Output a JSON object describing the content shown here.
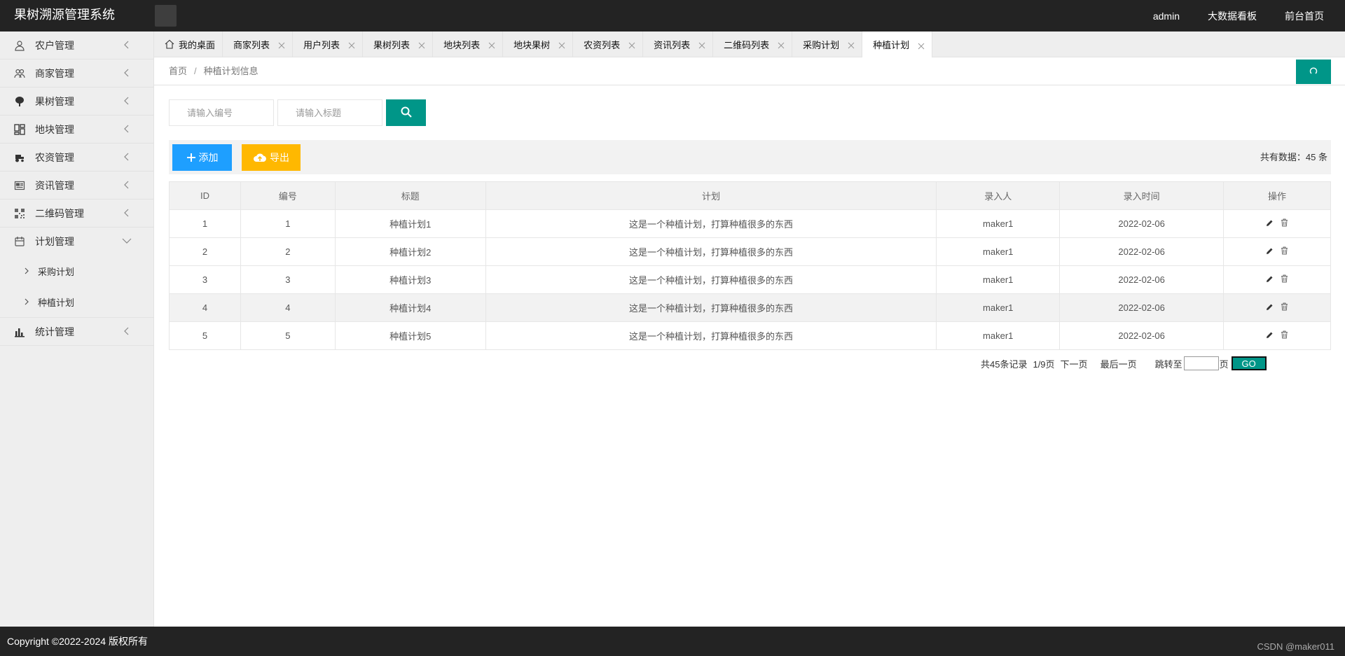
{
  "header": {
    "app_title": "果树溯源管理系统",
    "user": "admin",
    "links": [
      "大数据看板",
      "前台首页"
    ]
  },
  "sidebar": {
    "items": [
      {
        "label": "农户管理",
        "icon": "user-icon"
      },
      {
        "label": "商家管理",
        "icon": "users-icon"
      },
      {
        "label": "果树管理",
        "icon": "tree-icon"
      },
      {
        "label": "地块管理",
        "icon": "blocks-icon"
      },
      {
        "label": "农资管理",
        "icon": "tractor-icon"
      },
      {
        "label": "资讯管理",
        "icon": "news-icon"
      },
      {
        "label": "二维码管理",
        "icon": "qrcode-icon"
      },
      {
        "label": "计划管理",
        "icon": "plan-icon",
        "expanded": true
      },
      {
        "label": "统计管理",
        "icon": "chart-icon"
      }
    ],
    "sub_items": [
      "采购计划",
      "种植计划"
    ]
  },
  "tabs": [
    {
      "label": "我的桌面",
      "home": true
    },
    {
      "label": "商家列表"
    },
    {
      "label": "用户列表"
    },
    {
      "label": "果树列表"
    },
    {
      "label": "地块列表"
    },
    {
      "label": "地块果树"
    },
    {
      "label": "农资列表"
    },
    {
      "label": "资讯列表"
    },
    {
      "label": "二维码列表"
    },
    {
      "label": "采购计划"
    },
    {
      "label": "种植计划",
      "active": true
    }
  ],
  "breadcrumb": {
    "home": "首页",
    "sep": "/",
    "current": "种植计划信息"
  },
  "search": {
    "code_placeholder": "请输入编号",
    "title_placeholder": "请输入标题"
  },
  "toolbar": {
    "add_label": "添加",
    "export_label": "导出",
    "total_text": "共有数据：45 条"
  },
  "table": {
    "headers": [
      "ID",
      "编号",
      "标题",
      "计划",
      "录入人",
      "录入时间",
      "操作"
    ],
    "rows": [
      [
        "1",
        "1",
        "种植计划1",
        "这是一个种植计划，打算种植很多的东西",
        "maker1",
        "2022-02-06"
      ],
      [
        "2",
        "2",
        "种植计划2",
        "这是一个种植计划，打算种植很多的东西",
        "maker1",
        "2022-02-06"
      ],
      [
        "3",
        "3",
        "种植计划3",
        "这是一个种植计划，打算种植很多的东西",
        "maker1",
        "2022-02-06"
      ],
      [
        "4",
        "4",
        "种植计划4",
        "这是一个种植计划，打算种植很多的东西",
        "maker1",
        "2022-02-06"
      ],
      [
        "5",
        "5",
        "种植计划5",
        "这是一个种植计划，打算种植很多的东西",
        "maker1",
        "2022-02-06"
      ]
    ]
  },
  "pager": {
    "records": "共45条记录",
    "page": "1/9页",
    "next": "下一页",
    "last": "最后一页",
    "jump": "跳转至",
    "page_unit": "页",
    "go": "GO"
  },
  "footer": {
    "copyright": "Copyright ©2022-2024 版权所有",
    "watermark": "CSDN @maker011"
  },
  "colors": {
    "header_bg": "#232323",
    "primary": "#009688",
    "blue": "#1e9fff",
    "orange": "#ffb800"
  }
}
